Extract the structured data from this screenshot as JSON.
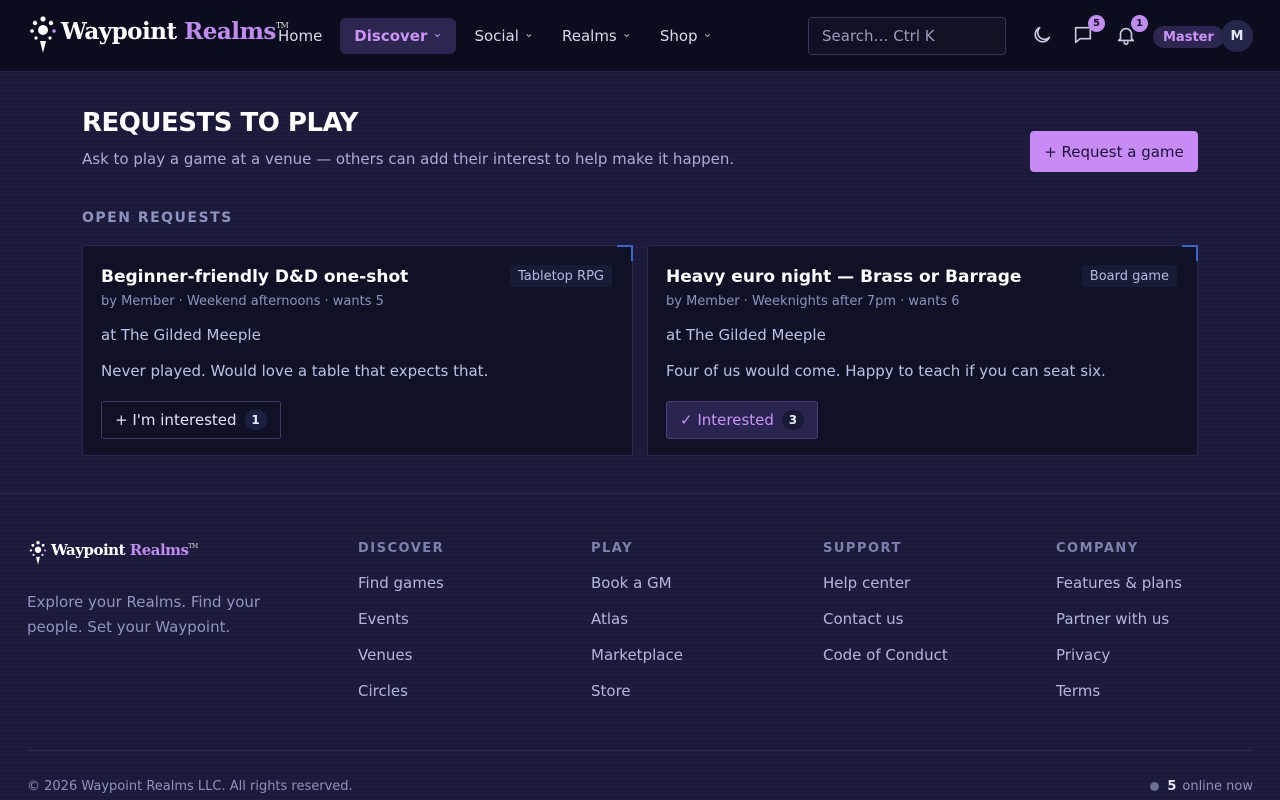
{
  "header": {
    "brand": {
      "name_main": "Waypoint",
      "name_accent": "Realms",
      "mark": "TM"
    },
    "nav": [
      {
        "label": "Home",
        "has_menu": false,
        "active": false
      },
      {
        "label": "Discover",
        "has_menu": true,
        "active": true
      },
      {
        "label": "Social",
        "has_menu": true,
        "active": false
      },
      {
        "label": "Realms",
        "has_menu": true,
        "active": false
      },
      {
        "label": "Shop",
        "has_menu": true,
        "active": false
      }
    ],
    "search": {
      "placeholder": "Search… Ctrl K"
    },
    "icons": {
      "theme": "moon-icon",
      "messages": "chat-bubble-icon",
      "notifications": "bell-icon"
    },
    "messages_count": "5",
    "notifications_count": "1",
    "role": "Master",
    "avatar_initial": "M"
  },
  "main": {
    "title": "Requests to play",
    "subtitle": "Ask to play a game at a venue — others can add their interest to help make it happen.",
    "cta_label": "+ Request a game",
    "section_label": "OPEN REQUESTS",
    "requests": [
      {
        "title": "Beginner-friendly D&D one-shot",
        "tag": "Tabletop RPG",
        "meta": "by Member · Weekend afternoons · wants 5",
        "venue": "at The Gilded Meeple",
        "note": "Never played. Would love a table that expects that.",
        "button_label": "+ I'm interested",
        "interest_count": "1",
        "interested": false
      },
      {
        "title": "Heavy euro night — Brass or Barrage",
        "tag": "Board game",
        "meta": "by Member · Weeknights after 7pm · wants 6",
        "venue": "at The Gilded Meeple",
        "note": "Four of us would come. Happy to teach if you can seat six.",
        "button_label": "✓ Interested",
        "interest_count": "3",
        "interested": true
      }
    ]
  },
  "footer": {
    "tagline": "Explore your Realms. Find your people. Set your Waypoint.",
    "columns": [
      {
        "heading": "DISCOVER",
        "links": [
          "Find games",
          "Events",
          "Venues",
          "Circles"
        ]
      },
      {
        "heading": "PLAY",
        "links": [
          "Book a GM",
          "Atlas",
          "Marketplace",
          "Store"
        ]
      },
      {
        "heading": "SUPPORT",
        "links": [
          "Help center",
          "Contact us",
          "Code of Conduct"
        ]
      },
      {
        "heading": "COMPANY",
        "links": [
          "Features & plans",
          "Partner with us",
          "Privacy",
          "Terms"
        ]
      }
    ],
    "copyright": "© 2026 Waypoint Realms LLC. All rights reserved.",
    "online_count": "5",
    "online_label": "online now"
  },
  "colors": {
    "accent": "#c88af5",
    "background": "#1b1a3a",
    "nav_bg": "#0b0d1e",
    "card_bg": "#0f1226"
  }
}
